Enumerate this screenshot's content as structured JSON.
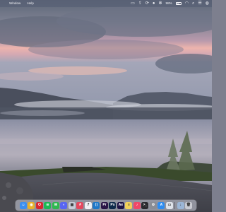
{
  "menubar": {
    "apple_icon": "apple-icon",
    "menus": [
      "Window",
      "Help"
    ],
    "status_icons": [
      "display-icon",
      "upload-icon",
      "sync-icon",
      "record-icon",
      "fan-icon",
      "battery-icon",
      "wifi-icon",
      "search-icon",
      "control-center-icon",
      "siri-icon"
    ],
    "battery_percent": "98%"
  },
  "dock": {
    "apps": [
      {
        "name": "finder-icon",
        "color": "#3b8ff2",
        "glyph": "☺"
      },
      {
        "name": "chrome-icon",
        "color": "#e8b12a",
        "glyph": "◉"
      },
      {
        "name": "opera-icon",
        "color": "#d8262f",
        "glyph": "O"
      },
      {
        "name": "spotify-icon",
        "color": "#1db954",
        "glyph": "≋"
      },
      {
        "name": "messages-icon",
        "color": "#2fb84f",
        "glyph": "✉"
      },
      {
        "name": "discord-icon",
        "color": "#5865f2",
        "glyph": "◐"
      },
      {
        "name": "launchpad-icon",
        "color": "#c7ccd8",
        "glyph": "▦"
      },
      {
        "name": "slack-icon",
        "color": "#e4475d",
        "glyph": "#"
      },
      {
        "name": "calendar-icon",
        "color": "#f1f1f4",
        "glyph": "7"
      },
      {
        "name": "vscode-icon",
        "color": "#1f78c8",
        "glyph": "⟨⟩"
      },
      {
        "name": "premiere-icon",
        "color": "#2a1446",
        "glyph": "Pr"
      },
      {
        "name": "photoshop-icon",
        "color": "#0d2a4a",
        "glyph": "Ps"
      },
      {
        "name": "aftereffects-icon",
        "color": "#1e1446",
        "glyph": "Ae"
      },
      {
        "name": "notes-icon",
        "color": "#f3d15a",
        "glyph": "≡"
      },
      {
        "name": "music-icon",
        "color": "#f04868",
        "glyph": "♪"
      },
      {
        "name": "terminal-icon",
        "color": "#2a2a2e",
        "glyph": ">_"
      },
      {
        "name": "system-settings-icon",
        "color": "#8a8d95",
        "glyph": "⚙"
      },
      {
        "name": "app-store-icon",
        "color": "#2d8cf0",
        "glyph": "A"
      },
      {
        "name": "preview-icon",
        "color": "#dfe3ea",
        "glyph": "▭"
      },
      {
        "name": "downloads-icon",
        "color": "#9bb6d6",
        "glyph": "↓"
      },
      {
        "name": "trash-icon",
        "color": "#c9cbd2",
        "glyph": "🗑"
      }
    ]
  }
}
